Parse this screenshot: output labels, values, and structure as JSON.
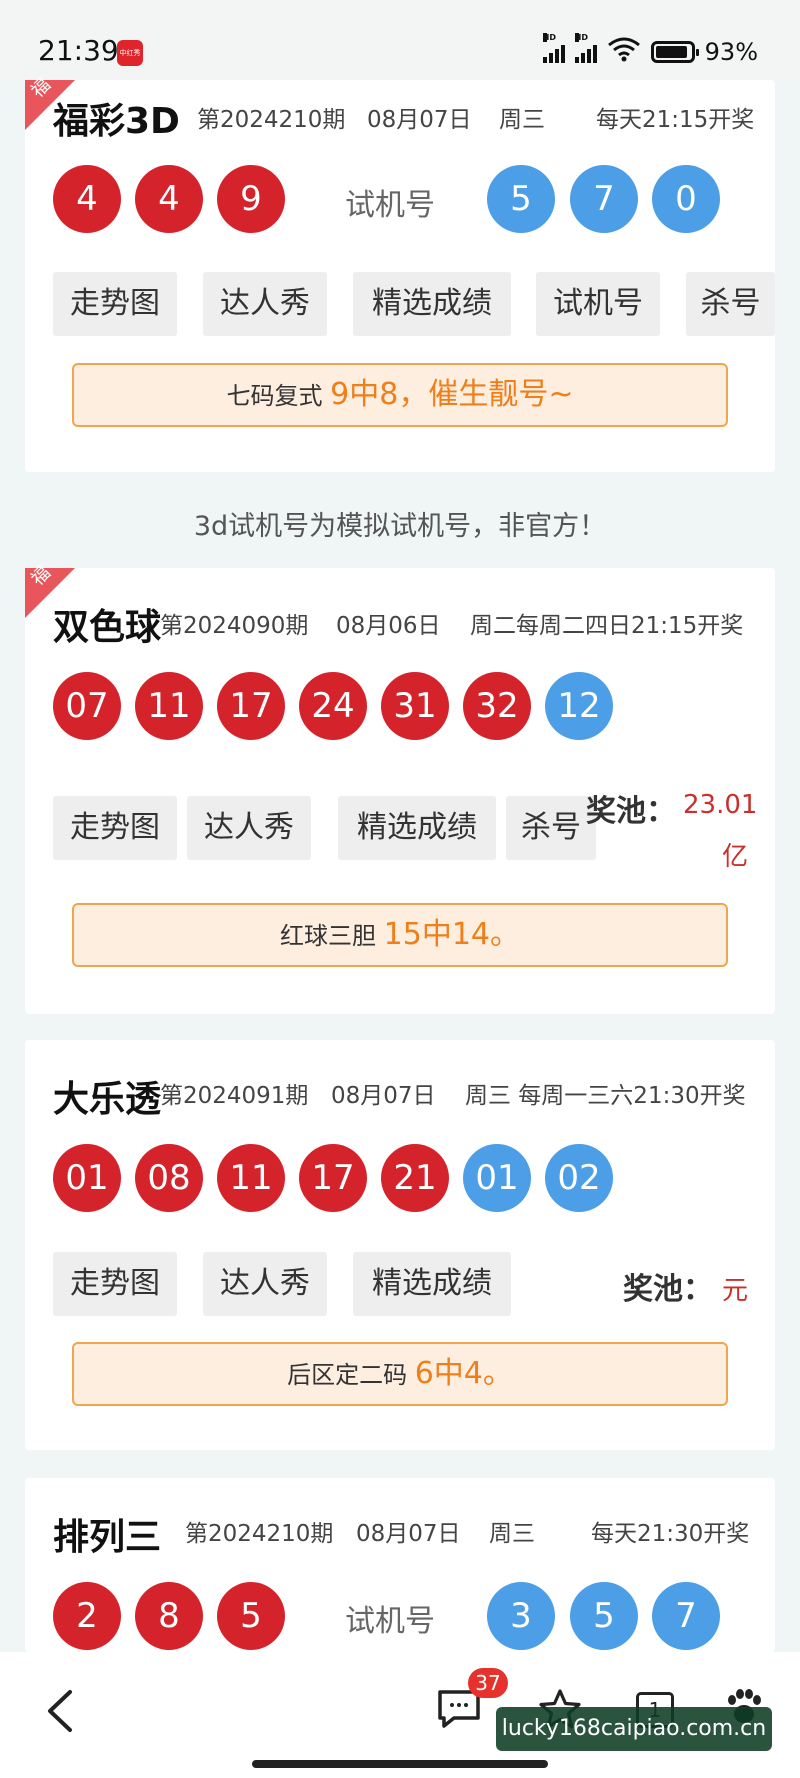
{
  "status_bar": {
    "time": "21:39",
    "app_icon_text": "中红秀",
    "battery": "93%",
    "battery_level": 0.93
  },
  "fucai3d": {
    "ribbon": "福",
    "name": "福彩3D",
    "issue": "第2024210期",
    "date": "08月07日",
    "weekday": "周三",
    "schedule": "每天21:15开奖",
    "balls": [
      "4",
      "4",
      "9"
    ],
    "trial_label": "试机号",
    "trial_balls": [
      "5",
      "7",
      "0"
    ],
    "buttons": [
      "走势图",
      "达人秀",
      "精选成绩",
      "试机号",
      "杀号"
    ],
    "promo_prefix": "七码复式",
    "promo_highlight": "9中8，催生靓号~"
  },
  "note": "3d试机号为模拟试机号，非官方！",
  "ssq": {
    "ribbon": "福",
    "name": "双色球",
    "issue": "第2024090期",
    "date": "08月06日",
    "weekday_schedule": "周二每周二四日21:15开奖",
    "red_balls": [
      "07",
      "11",
      "17",
      "24",
      "31",
      "32"
    ],
    "blue_balls": [
      "12"
    ],
    "buttons": [
      "走势图",
      "达人秀",
      "精选成绩",
      "杀号"
    ],
    "pool_label": "奖池：",
    "pool_value": "23.01",
    "pool_unit": "亿",
    "promo_prefix": "红球三胆",
    "promo_highlight": "15中14。"
  },
  "dlt": {
    "name": "大乐透",
    "issue": "第2024091期",
    "date": "08月07日",
    "weekday_schedule": "周三 每周一三六21:30开奖",
    "red_balls": [
      "01",
      "08",
      "11",
      "17",
      "21"
    ],
    "blue_balls": [
      "01",
      "02"
    ],
    "buttons": [
      "走势图",
      "达人秀",
      "精选成绩"
    ],
    "pool_label": "奖池：",
    "pool_unit": "元",
    "promo_prefix": "后区定二码",
    "promo_highlight": "6中4。"
  },
  "pl3": {
    "name": "排列三",
    "issue": "第2024210期",
    "date": "08月07日",
    "weekday": "周三",
    "schedule": "每天21:30开奖",
    "balls": [
      "2",
      "8",
      "5"
    ],
    "trial_label": "试机号",
    "trial_balls": [
      "3",
      "5",
      "7"
    ]
  },
  "bottom_nav": {
    "back_icon": "back-arrow-icon",
    "comment_badge": "37",
    "tab_count": "1"
  },
  "watermark": "lucky168caipiao.com.cn",
  "colors": {
    "red_ball": "#d5232c",
    "blue_ball": "#4c9ee6",
    "accent_orange": "#ef7f1a",
    "pool_red": "#c9302c"
  }
}
